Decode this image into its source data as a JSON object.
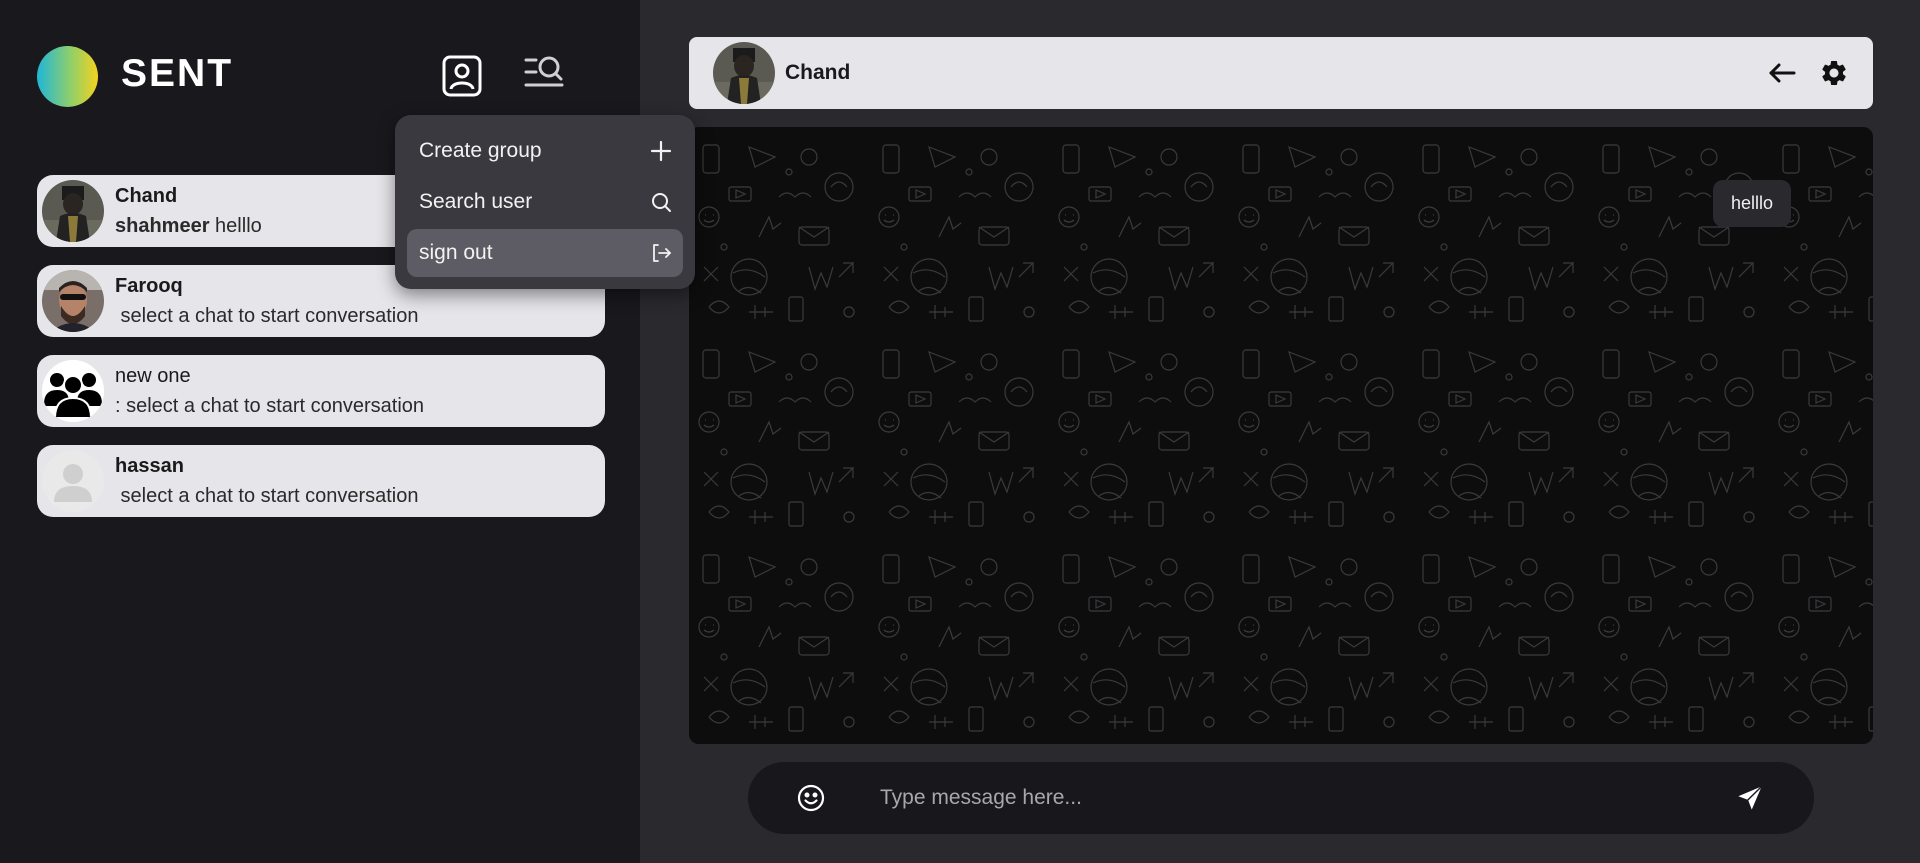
{
  "app": {
    "title": "SENT"
  },
  "header_icons": [
    "profile-icon",
    "search-menu-icon"
  ],
  "dropdown": {
    "items": [
      {
        "label": "Create group",
        "icon": "plus-icon"
      },
      {
        "label": "Search user",
        "icon": "search-icon"
      },
      {
        "label": "sign out",
        "icon": "sign-out-icon",
        "active": true
      }
    ]
  },
  "chats": [
    {
      "name": "Chand",
      "sender": "shahmeer",
      "preview": " helllo"
    },
    {
      "name": "Farooq",
      "preview": " select a chat to start conversation"
    },
    {
      "name": "new one",
      "preview": ": select a chat to start conversation"
    },
    {
      "name": "hassan",
      "preview": " select a chat to start conversation"
    }
  ],
  "chat_header": {
    "title": "Chand"
  },
  "messages": [
    {
      "text": "helllo"
    }
  ],
  "composer": {
    "placeholder": "Type message here..."
  },
  "colors": {
    "sidebar_bg": "#19181d",
    "main_bg": "#2a292e",
    "card_bg": "#e6e5ea",
    "dropdown_bg": "#3a3940",
    "chat_area_bg": "#0c0c0d"
  }
}
